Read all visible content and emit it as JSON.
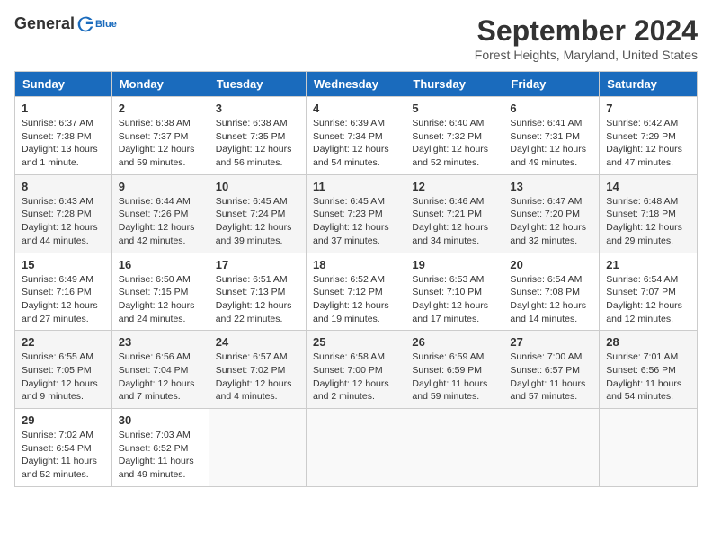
{
  "header": {
    "logo_general": "General",
    "logo_blue": "Blue",
    "month_title": "September 2024",
    "location": "Forest Heights, Maryland, United States"
  },
  "calendar": {
    "days_of_week": [
      "Sunday",
      "Monday",
      "Tuesday",
      "Wednesday",
      "Thursday",
      "Friday",
      "Saturday"
    ],
    "weeks": [
      [
        {
          "day": "1",
          "sunrise": "6:37 AM",
          "sunset": "7:38 PM",
          "daylight": "13 hours and 1 minute."
        },
        {
          "day": "2",
          "sunrise": "6:38 AM",
          "sunset": "7:37 PM",
          "daylight": "12 hours and 59 minutes."
        },
        {
          "day": "3",
          "sunrise": "6:38 AM",
          "sunset": "7:35 PM",
          "daylight": "12 hours and 56 minutes."
        },
        {
          "day": "4",
          "sunrise": "6:39 AM",
          "sunset": "7:34 PM",
          "daylight": "12 hours and 54 minutes."
        },
        {
          "day": "5",
          "sunrise": "6:40 AM",
          "sunset": "7:32 PM",
          "daylight": "12 hours and 52 minutes."
        },
        {
          "day": "6",
          "sunrise": "6:41 AM",
          "sunset": "7:31 PM",
          "daylight": "12 hours and 49 minutes."
        },
        {
          "day": "7",
          "sunrise": "6:42 AM",
          "sunset": "7:29 PM",
          "daylight": "12 hours and 47 minutes."
        }
      ],
      [
        {
          "day": "8",
          "sunrise": "6:43 AM",
          "sunset": "7:28 PM",
          "daylight": "12 hours and 44 minutes."
        },
        {
          "day": "9",
          "sunrise": "6:44 AM",
          "sunset": "7:26 PM",
          "daylight": "12 hours and 42 minutes."
        },
        {
          "day": "10",
          "sunrise": "6:45 AM",
          "sunset": "7:24 PM",
          "daylight": "12 hours and 39 minutes."
        },
        {
          "day": "11",
          "sunrise": "6:45 AM",
          "sunset": "7:23 PM",
          "daylight": "12 hours and 37 minutes."
        },
        {
          "day": "12",
          "sunrise": "6:46 AM",
          "sunset": "7:21 PM",
          "daylight": "12 hours and 34 minutes."
        },
        {
          "day": "13",
          "sunrise": "6:47 AM",
          "sunset": "7:20 PM",
          "daylight": "12 hours and 32 minutes."
        },
        {
          "day": "14",
          "sunrise": "6:48 AM",
          "sunset": "7:18 PM",
          "daylight": "12 hours and 29 minutes."
        }
      ],
      [
        {
          "day": "15",
          "sunrise": "6:49 AM",
          "sunset": "7:16 PM",
          "daylight": "12 hours and 27 minutes."
        },
        {
          "day": "16",
          "sunrise": "6:50 AM",
          "sunset": "7:15 PM",
          "daylight": "12 hours and 24 minutes."
        },
        {
          "day": "17",
          "sunrise": "6:51 AM",
          "sunset": "7:13 PM",
          "daylight": "12 hours and 22 minutes."
        },
        {
          "day": "18",
          "sunrise": "6:52 AM",
          "sunset": "7:12 PM",
          "daylight": "12 hours and 19 minutes."
        },
        {
          "day": "19",
          "sunrise": "6:53 AM",
          "sunset": "7:10 PM",
          "daylight": "12 hours and 17 minutes."
        },
        {
          "day": "20",
          "sunrise": "6:54 AM",
          "sunset": "7:08 PM",
          "daylight": "12 hours and 14 minutes."
        },
        {
          "day": "21",
          "sunrise": "6:54 AM",
          "sunset": "7:07 PM",
          "daylight": "12 hours and 12 minutes."
        }
      ],
      [
        {
          "day": "22",
          "sunrise": "6:55 AM",
          "sunset": "7:05 PM",
          "daylight": "12 hours and 9 minutes."
        },
        {
          "day": "23",
          "sunrise": "6:56 AM",
          "sunset": "7:04 PM",
          "daylight": "12 hours and 7 minutes."
        },
        {
          "day": "24",
          "sunrise": "6:57 AM",
          "sunset": "7:02 PM",
          "daylight": "12 hours and 4 minutes."
        },
        {
          "day": "25",
          "sunrise": "6:58 AM",
          "sunset": "7:00 PM",
          "daylight": "12 hours and 2 minutes."
        },
        {
          "day": "26",
          "sunrise": "6:59 AM",
          "sunset": "6:59 PM",
          "daylight": "11 hours and 59 minutes."
        },
        {
          "day": "27",
          "sunrise": "7:00 AM",
          "sunset": "6:57 PM",
          "daylight": "11 hours and 57 minutes."
        },
        {
          "day": "28",
          "sunrise": "7:01 AM",
          "sunset": "6:56 PM",
          "daylight": "11 hours and 54 minutes."
        }
      ],
      [
        {
          "day": "29",
          "sunrise": "7:02 AM",
          "sunset": "6:54 PM",
          "daylight": "11 hours and 52 minutes."
        },
        {
          "day": "30",
          "sunrise": "7:03 AM",
          "sunset": "6:52 PM",
          "daylight": "11 hours and 49 minutes."
        },
        null,
        null,
        null,
        null,
        null
      ]
    ]
  }
}
